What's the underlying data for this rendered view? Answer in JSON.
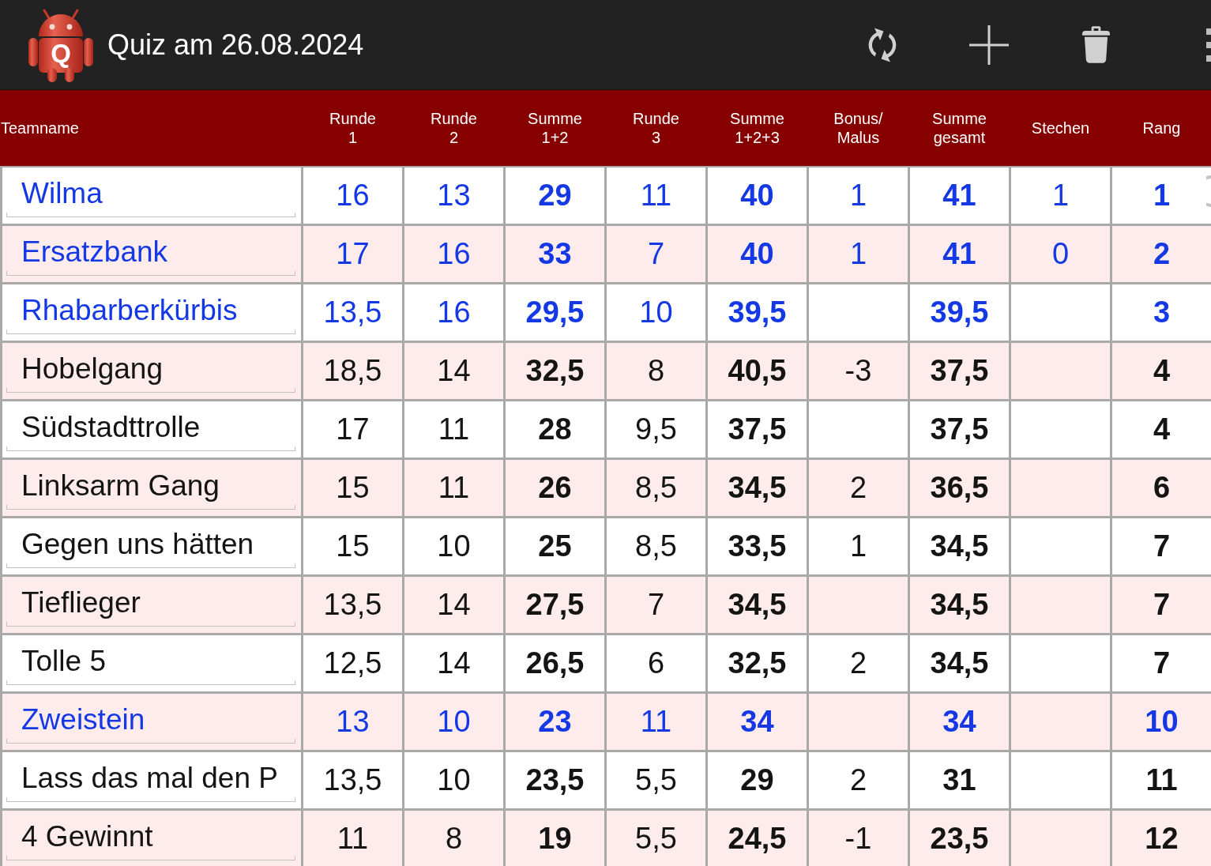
{
  "app_bar": {
    "logo_letter": "Q",
    "title": "Quiz am 26.08.2024"
  },
  "table": {
    "columns": [
      {
        "label": "Teamname",
        "kind": "name"
      },
      {
        "label": "Runde\n1",
        "kind": "score"
      },
      {
        "label": "Runde\n2",
        "kind": "score"
      },
      {
        "label": "Summe\n1+2",
        "kind": "total"
      },
      {
        "label": "Runde\n3",
        "kind": "score"
      },
      {
        "label": "Summe\n1+2+3",
        "kind": "total"
      },
      {
        "label": "Bonus/\nMalus",
        "kind": "score"
      },
      {
        "label": "Summe\ngesamt",
        "kind": "total"
      },
      {
        "label": "Stechen",
        "kind": "score"
      },
      {
        "label": "Rang",
        "kind": "total"
      }
    ],
    "rows": [
      {
        "highlighted": true,
        "cells": [
          "Wilma",
          "16",
          "13",
          "29",
          "11",
          "40",
          "1",
          "41",
          "1",
          "1"
        ]
      },
      {
        "highlighted": true,
        "cells": [
          "Ersatzbank",
          "17",
          "16",
          "33",
          "7",
          "40",
          "1",
          "41",
          "0",
          "2"
        ]
      },
      {
        "highlighted": true,
        "cells": [
          "Rhabarberkürbis",
          "13,5",
          "16",
          "29,5",
          "10",
          "39,5",
          null,
          "39,5",
          null,
          "3"
        ]
      },
      {
        "highlighted": false,
        "cells": [
          "Hobelgang",
          "18,5",
          "14",
          "32,5",
          "8",
          "40,5",
          "-3",
          "37,5",
          null,
          "4"
        ]
      },
      {
        "highlighted": false,
        "cells": [
          "Südstadttrolle",
          "17",
          "11",
          "28",
          "9,5",
          "37,5",
          null,
          "37,5",
          null,
          "4"
        ]
      },
      {
        "highlighted": false,
        "cells": [
          "Linksarm Gang",
          "15",
          "11",
          "26",
          "8,5",
          "34,5",
          "2",
          "36,5",
          null,
          "6"
        ]
      },
      {
        "highlighted": false,
        "cells": [
          "Gegen uns hätten",
          "15",
          "10",
          "25",
          "8,5",
          "33,5",
          "1",
          "34,5",
          null,
          "7"
        ]
      },
      {
        "highlighted": false,
        "cells": [
          "Tieflieger",
          "13,5",
          "14",
          "27,5",
          "7",
          "34,5",
          null,
          "34,5",
          null,
          "7"
        ]
      },
      {
        "highlighted": false,
        "cells": [
          "Tolle 5",
          "12,5",
          "14",
          "26,5",
          "6",
          "32,5",
          "2",
          "34,5",
          null,
          "7"
        ]
      },
      {
        "highlighted": true,
        "cells": [
          "Zweistein",
          "13",
          "10",
          "23",
          "11",
          "34",
          null,
          "34",
          null,
          "10"
        ]
      },
      {
        "highlighted": false,
        "cells": [
          "Lass das mal den P",
          "13,5",
          "10",
          "23,5",
          "5,5",
          "29",
          "2",
          "31",
          null,
          "11"
        ]
      },
      {
        "highlighted": false,
        "cells": [
          "4 Gewinnt",
          "11",
          "8",
          "19",
          "5,5",
          "24,5",
          "-1",
          "23,5",
          null,
          "12"
        ]
      }
    ]
  }
}
